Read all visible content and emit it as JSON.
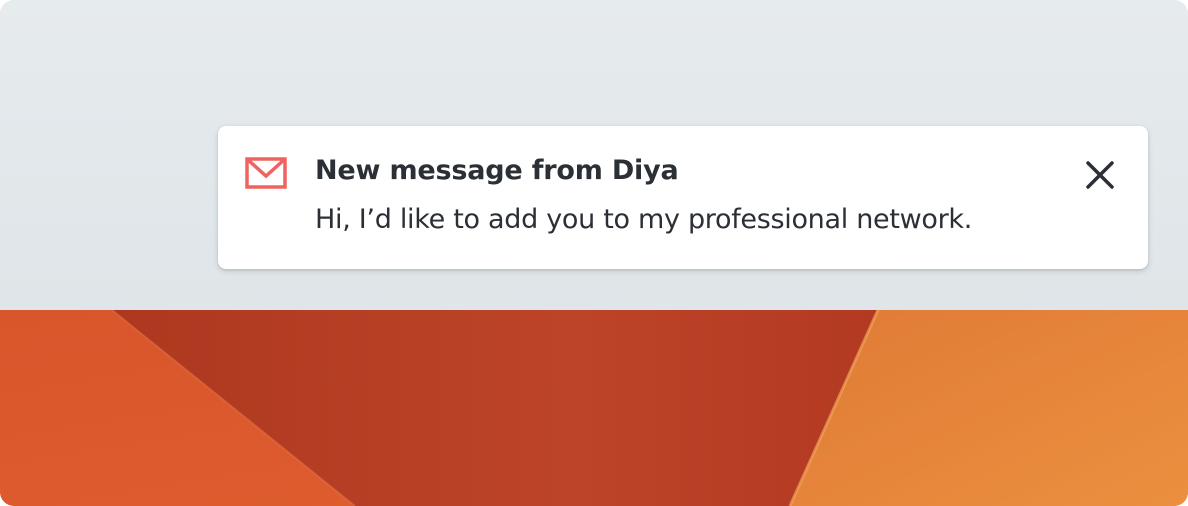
{
  "notification": {
    "title": "New message from Diya",
    "message": "Hi, I’d like to add you to my professional network.",
    "icon": "mail-icon",
    "close_icon": "close-icon"
  },
  "colors": {
    "icon_accent": "#f0625f",
    "text": "#2b2f36",
    "toast_background": "#ffffff",
    "top_background": "#e3e9ec",
    "wallpaper_dark": "#b63d24",
    "wallpaper_mid": "#de5a2c",
    "wallpaper_light": "#e8873a"
  }
}
